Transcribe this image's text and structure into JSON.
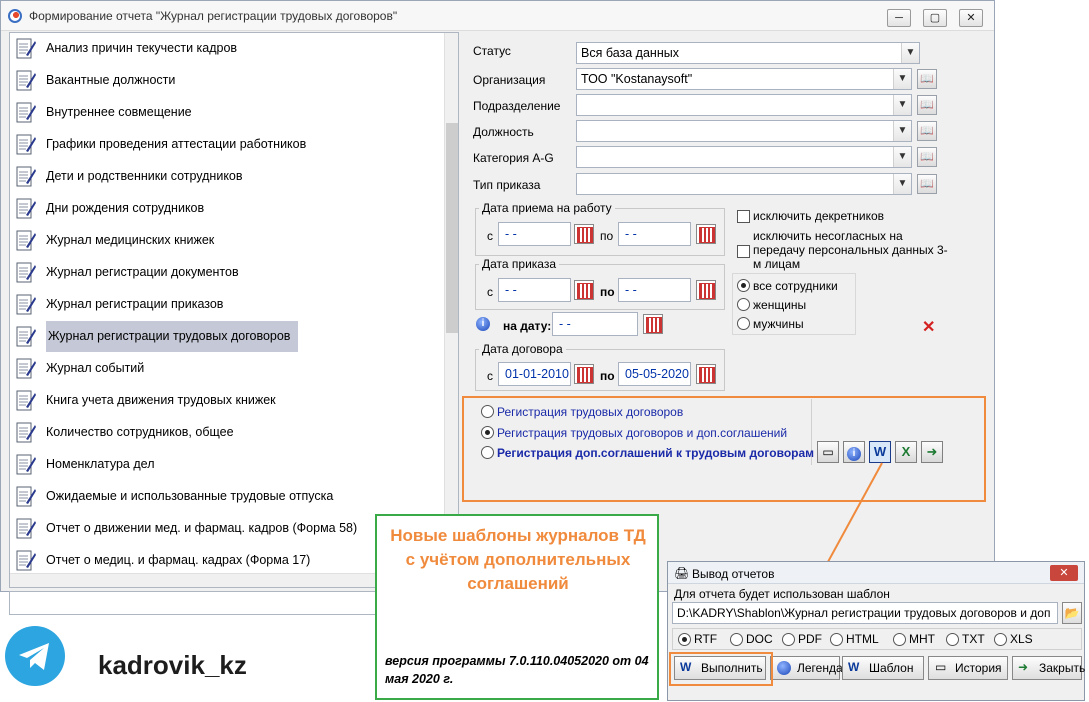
{
  "window": {
    "title": "Формирование отчета \"Журнал регистрации трудовых договоров\"",
    "btn_min": "─",
    "btn_max": "▢",
    "btn_close": "✕"
  },
  "report_list": {
    "items": [
      "Анализ причин текучести кадров",
      "Вакантные должности",
      "Внутреннее совмещение",
      "Графики проведения аттестации работников",
      "Дети и родственники сотрудников",
      "Дни рождения сотрудников",
      "Журнал медицинских книжек",
      "Журнал регистрации документов",
      "Журнал регистрации приказов",
      "Журнал регистрации трудовых договоров",
      "Журнал событий",
      "Книга учета движения трудовых книжек",
      "Количество сотрудников, общее",
      "Номенклатура дел",
      "Ожидаемые и использованные трудовые отпуска",
      "Отчет о движении мед. и фармац. кадров (Форма 58)",
      "Отчет о медиц. и фармац. кадрах (Форма 17)"
    ],
    "selected_index": 9
  },
  "filters": {
    "status_label": "Статус",
    "status_value": "Вся база данных",
    "org_label": "Организация",
    "org_value": "ТОО \"Kostanaysoft\"",
    "dept_label": "Подразделение",
    "dept_value": "",
    "position_label": "Должность",
    "position_value": "",
    "category_label": "Категория A-G",
    "category_value": "",
    "order_type_label": "Тип приказа",
    "order_type_value": ""
  },
  "dates": {
    "hire_title": "Дата приема на работу",
    "from_label": "с",
    "to_label": "по",
    "hire_from": " -  - ",
    "hire_to": " -  - ",
    "order_title": "Дата приказа",
    "order_from": " -  - ",
    "order_to": " -  - ",
    "on_date_label": "на дату:",
    "on_date_value": " -  - ",
    "contract_title": "Дата договора",
    "contract_from": "01-01-2010",
    "contract_to": "05-05-2020"
  },
  "options": {
    "exclude_maternity": "исключить декретников",
    "exclude_disagree": "исключить несогласных на передачу персональных данных 3-м лицам",
    "gender_all": "все сотрудники",
    "gender_women": "женщины",
    "gender_men": "мужчины"
  },
  "templates": {
    "opt1": "Регистрация трудовых договоров",
    "opt2": "Регистрация трудовых договоров и доп.соглашений",
    "opt3": "Регистрация доп.соглашений к трудовым договорам",
    "selected_index": 1
  },
  "annotation": {
    "headline": "Новые шаблоны журналов ТД с учётом дополнительных соглашений",
    "version": "версия программы 7.0.110.04052020 от 04 мая 2020 г."
  },
  "branding": {
    "handle": "kadrovik_kz"
  },
  "output_dialog": {
    "title": "Вывод отчетов",
    "template_label": "Для отчета будет использован шаблон",
    "template_path": "D:\\KADRY\\Shablon\\Журнал регистрации трудовых договоров и доп",
    "formats": [
      "RTF",
      "DOC",
      "PDF",
      "HTML",
      "MHT",
      "TXT",
      "XLS"
    ],
    "selected_format": 0,
    "btn_run": "Выполнить",
    "btn_legend": "Легенда",
    "btn_template": "Шаблон",
    "btn_history": "История",
    "btn_close": "Закрыть"
  },
  "colors": {
    "highlight_orange": "#f08a3c",
    "annotation_green": "#3aaa48",
    "annotation_text": "#f08a3c",
    "telegram": "#2ca5e0"
  }
}
